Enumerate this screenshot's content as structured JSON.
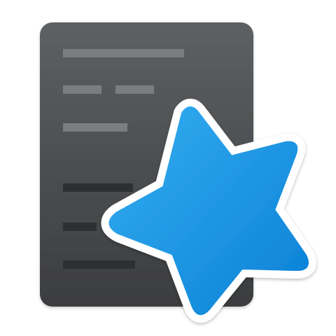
{
  "icon": {
    "semantic": "anki-app-icon",
    "elements": {
      "document": "document-card-icon",
      "star": "star-icon"
    },
    "colors": {
      "card_dark": "#3b3d3f",
      "card_light": "#5d6063",
      "line_light": "#7b7e81",
      "line_dark": "#2d2f31",
      "star_light": "#35aef0",
      "star_dark": "#0a80d6",
      "star_outline": "#ffffff"
    }
  }
}
